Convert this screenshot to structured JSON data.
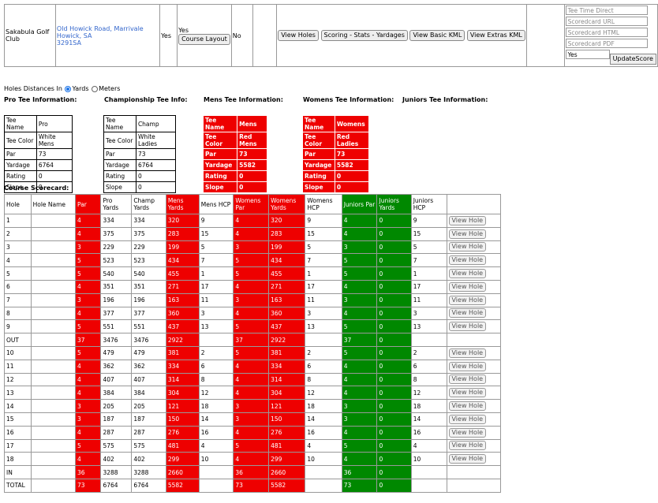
{
  "club": {
    "name": "Sakabula Golf Club",
    "address": [
      "Old Howick Road, Marrivale",
      "Howick, SA",
      "3291SA"
    ],
    "yes1": "Yes",
    "yes2": "Yes",
    "course_layout": "Course Layout",
    "no": "No",
    "buttons": [
      "View Holes",
      "Scoring - Stats - Yardages",
      "View Basic KML",
      "View Extras KML"
    ],
    "inputs": [
      "Tee Time Direct",
      "Scoredcard URL",
      "Scoredcard HTML",
      "Scoredcard PDF"
    ],
    "yes_input": "Yes",
    "update_btn": "UpdateScore"
  },
  "distance": {
    "label": "Holes Distances In",
    "yards": "Yards",
    "meters": "Meters",
    "selected": "yards"
  },
  "tees": [
    {
      "heading": "Pro Tee Information:",
      "color_scheme": "plain",
      "rows": [
        [
          "Tee Name",
          "Pro"
        ],
        [
          "Tee Color",
          "White Mens"
        ],
        [
          "Par",
          "73"
        ],
        [
          "Yardage",
          "6764"
        ],
        [
          "Rating",
          "0"
        ],
        [
          "Slope",
          "0"
        ]
      ]
    },
    {
      "heading": "Championship Tee Info:",
      "color_scheme": "plain",
      "rows": [
        [
          "Tee Name",
          "Champ"
        ],
        [
          "Tee Color",
          "White Ladies"
        ],
        [
          "Par",
          "73"
        ],
        [
          "Yardage",
          "6764"
        ],
        [
          "Rating",
          "0"
        ],
        [
          "Slope",
          "0"
        ]
      ]
    },
    {
      "heading": "Mens Tee Information:",
      "color_scheme": "red",
      "rows": [
        [
          "Tee Name",
          "Mens"
        ],
        [
          "Tee Color",
          "Red Mens"
        ],
        [
          "Par",
          "73"
        ],
        [
          "Yardage",
          "5582"
        ],
        [
          "Rating",
          "0"
        ],
        [
          "Slope",
          "0"
        ]
      ]
    },
    {
      "heading": "Womens Tee Information:",
      "color_scheme": "red",
      "rows": [
        [
          "Tee Name",
          "Womens"
        ],
        [
          "Tee Color",
          "Red Ladies"
        ],
        [
          "Par",
          "73"
        ],
        [
          "Yardage",
          "5582"
        ],
        [
          "Rating",
          "0"
        ],
        [
          "Slope",
          "0"
        ]
      ]
    },
    {
      "heading": "Juniors Tee Information:",
      "color_scheme": "none",
      "rows": []
    }
  ],
  "scorecard": {
    "title": "Course Scorecard:",
    "headers": [
      "Hole",
      "Hole Name",
      "Par",
      "Pro Yards",
      "Champ Yards",
      "Mens Yards",
      "Mens HCP",
      "Womens Par",
      "Womens Yards",
      "Womens HCP",
      "Juniors Par",
      "Juniors Yards",
      "Juniors HCP",
      ""
    ],
    "view_label": "View Hole",
    "rows": [
      [
        "1",
        "",
        "4",
        "334",
        "334",
        "320",
        "9",
        "4",
        "320",
        "9",
        "4",
        "0",
        "9",
        true
      ],
      [
        "2",
        "",
        "4",
        "375",
        "375",
        "283",
        "15",
        "4",
        "283",
        "15",
        "4",
        "0",
        "15",
        true
      ],
      [
        "3",
        "",
        "3",
        "229",
        "229",
        "199",
        "5",
        "3",
        "199",
        "5",
        "3",
        "0",
        "5",
        true
      ],
      [
        "4",
        "",
        "5",
        "523",
        "523",
        "434",
        "7",
        "5",
        "434",
        "7",
        "5",
        "0",
        "7",
        true
      ],
      [
        "5",
        "",
        "5",
        "540",
        "540",
        "455",
        "1",
        "5",
        "455",
        "1",
        "5",
        "0",
        "1",
        true
      ],
      [
        "6",
        "",
        "4",
        "351",
        "351",
        "271",
        "17",
        "4",
        "271",
        "17",
        "4",
        "0",
        "17",
        true
      ],
      [
        "7",
        "",
        "3",
        "196",
        "196",
        "163",
        "11",
        "3",
        "163",
        "11",
        "3",
        "0",
        "11",
        true
      ],
      [
        "8",
        "",
        "4",
        "377",
        "377",
        "360",
        "3",
        "4",
        "360",
        "3",
        "4",
        "0",
        "3",
        true
      ],
      [
        "9",
        "",
        "5",
        "551",
        "551",
        "437",
        "13",
        "5",
        "437",
        "13",
        "5",
        "0",
        "13",
        true
      ],
      [
        "OUT",
        "",
        "37",
        "3476",
        "3476",
        "2922",
        "",
        "37",
        "2922",
        "",
        "37",
        "0",
        "",
        false
      ],
      [
        "10",
        "",
        "5",
        "479",
        "479",
        "381",
        "2",
        "5",
        "381",
        "2",
        "5",
        "0",
        "2",
        true
      ],
      [
        "11",
        "",
        "4",
        "362",
        "362",
        "334",
        "6",
        "4",
        "334",
        "6",
        "4",
        "0",
        "6",
        true
      ],
      [
        "12",
        "",
        "4",
        "407",
        "407",
        "314",
        "8",
        "4",
        "314",
        "8",
        "4",
        "0",
        "8",
        true
      ],
      [
        "13",
        "",
        "4",
        "384",
        "384",
        "304",
        "12",
        "4",
        "304",
        "12",
        "4",
        "0",
        "12",
        true
      ],
      [
        "14",
        "",
        "3",
        "205",
        "205",
        "121",
        "18",
        "3",
        "121",
        "18",
        "3",
        "0",
        "18",
        true
      ],
      [
        "15",
        "",
        "3",
        "187",
        "187",
        "150",
        "14",
        "3",
        "150",
        "14",
        "3",
        "0",
        "14",
        true
      ],
      [
        "16",
        "",
        "4",
        "287",
        "287",
        "276",
        "16",
        "4",
        "276",
        "16",
        "4",
        "0",
        "16",
        true
      ],
      [
        "17",
        "",
        "5",
        "575",
        "575",
        "481",
        "4",
        "5",
        "481",
        "4",
        "5",
        "0",
        "4",
        true
      ],
      [
        "18",
        "",
        "4",
        "402",
        "402",
        "299",
        "10",
        "4",
        "299",
        "10",
        "4",
        "0",
        "10",
        true
      ],
      [
        "IN",
        "",
        "36",
        "3288",
        "3288",
        "2660",
        "",
        "36",
        "2660",
        "",
        "36",
        "0",
        "",
        false
      ],
      [
        "TOTAL",
        "",
        "73",
        "6764",
        "6764",
        "5582",
        "",
        "73",
        "5582",
        "",
        "73",
        "0",
        "",
        false
      ]
    ]
  },
  "colors": {
    "red": "#ee0000",
    "green": "#008800"
  }
}
